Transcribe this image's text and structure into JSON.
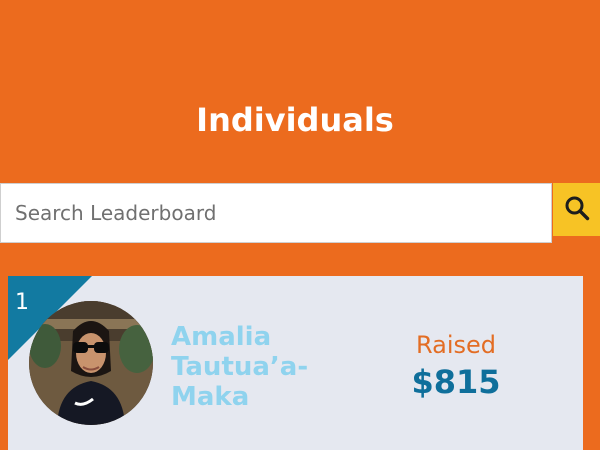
{
  "header": {
    "title": "Individuals"
  },
  "search": {
    "placeholder": "Search Leaderboard",
    "button_icon": "search-icon"
  },
  "leaderboard": [
    {
      "rank": "1",
      "name": "Amalia Tautua’a-Maka",
      "raised_label": "Raised",
      "raised_amount": "$815",
      "avatar_icon": "avatar-photo"
    }
  ],
  "colors": {
    "background": "#ec6b1e",
    "search_button": "#f7c325",
    "card": "#e5e8f0",
    "rank_flag": "#127aa1",
    "name": "#8fd3ee",
    "raised_label": "#e36d24",
    "raised_amount": "#0f6f9b"
  }
}
